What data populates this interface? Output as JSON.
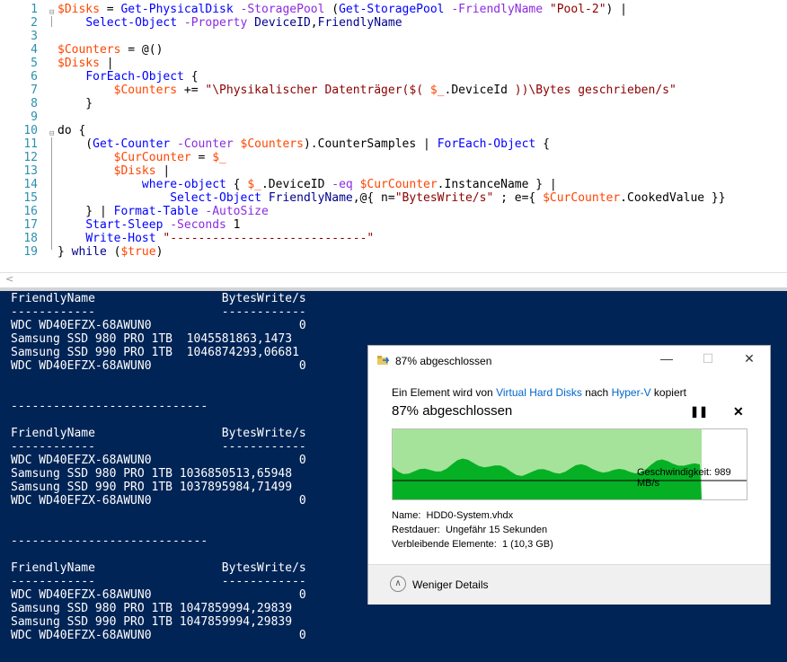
{
  "editor": {
    "line_numbers": [
      "1",
      "2",
      "3",
      "4",
      "5",
      "6",
      "7",
      "8",
      "9",
      "10",
      "11",
      "12",
      "13",
      "14",
      "15",
      "16",
      "17",
      "18",
      "19"
    ],
    "lines": [
      [
        {
          "c": "v",
          "t": "$Disks"
        },
        {
          "c": "t",
          "t": " = "
        },
        {
          "c": "c",
          "t": "Get-PhysicalDisk"
        },
        {
          "c": "t",
          "t": " "
        },
        {
          "c": "p",
          "t": "-StoragePool"
        },
        {
          "c": "t",
          "t": " ("
        },
        {
          "c": "c",
          "t": "Get-StoragePool"
        },
        {
          "c": "t",
          "t": " "
        },
        {
          "c": "p",
          "t": "-FriendlyName"
        },
        {
          "c": "t",
          "t": " "
        },
        {
          "c": "s",
          "t": "\"Pool-2\""
        },
        {
          "c": "t",
          "t": ") |"
        }
      ],
      [
        {
          "c": "t",
          "t": "    "
        },
        {
          "c": "c",
          "t": "Select-Object"
        },
        {
          "c": "t",
          "t": " "
        },
        {
          "c": "p",
          "t": "-Property"
        },
        {
          "c": "t",
          "t": " "
        },
        {
          "c": "k",
          "t": "DeviceID"
        },
        {
          "c": "t",
          "t": ","
        },
        {
          "c": "k",
          "t": "FriendlyName"
        }
      ],
      [],
      [
        {
          "c": "v",
          "t": "$Counters"
        },
        {
          "c": "t",
          "t": " = @()"
        }
      ],
      [
        {
          "c": "v",
          "t": "$Disks"
        },
        {
          "c": "t",
          "t": " |"
        }
      ],
      [
        {
          "c": "t",
          "t": "    "
        },
        {
          "c": "c",
          "t": "ForEach-Object"
        },
        {
          "c": "t",
          "t": " {"
        }
      ],
      [
        {
          "c": "t",
          "t": "        "
        },
        {
          "c": "v",
          "t": "$Counters"
        },
        {
          "c": "t",
          "t": " += "
        },
        {
          "c": "s",
          "t": "\"\\Physikalischer Datenträger($( "
        },
        {
          "c": "v",
          "t": "$_"
        },
        {
          "c": "t",
          "t": ".DeviceId "
        },
        {
          "c": "s",
          "t": "))\\Bytes geschrieben/s\""
        }
      ],
      [
        {
          "c": "t",
          "t": "    }"
        }
      ],
      [],
      [
        {
          "c": "t",
          "t": "do {"
        }
      ],
      [
        {
          "c": "t",
          "t": "    ("
        },
        {
          "c": "c",
          "t": "Get-Counter"
        },
        {
          "c": "t",
          "t": " "
        },
        {
          "c": "p",
          "t": "-Counter"
        },
        {
          "c": "t",
          "t": " "
        },
        {
          "c": "v",
          "t": "$Counters"
        },
        {
          "c": "t",
          "t": ").CounterSamples | "
        },
        {
          "c": "c",
          "t": "ForEach-Object"
        },
        {
          "c": "t",
          "t": " {"
        }
      ],
      [
        {
          "c": "t",
          "t": "        "
        },
        {
          "c": "v",
          "t": "$CurCounter"
        },
        {
          "c": "t",
          "t": " = "
        },
        {
          "c": "v",
          "t": "$_"
        }
      ],
      [
        {
          "c": "t",
          "t": "        "
        },
        {
          "c": "v",
          "t": "$Disks"
        },
        {
          "c": "t",
          "t": " |"
        }
      ],
      [
        {
          "c": "t",
          "t": "            "
        },
        {
          "c": "c",
          "t": "where-object"
        },
        {
          "c": "t",
          "t": " { "
        },
        {
          "c": "v",
          "t": "$_"
        },
        {
          "c": "t",
          "t": ".DeviceID "
        },
        {
          "c": "p",
          "t": "-eq"
        },
        {
          "c": "t",
          "t": " "
        },
        {
          "c": "v",
          "t": "$CurCounter"
        },
        {
          "c": "t",
          "t": ".InstanceName } |"
        }
      ],
      [
        {
          "c": "t",
          "t": "                "
        },
        {
          "c": "c",
          "t": "Select-Object"
        },
        {
          "c": "t",
          "t": " "
        },
        {
          "c": "k",
          "t": "FriendlyName"
        },
        {
          "c": "t",
          "t": ",@{ n="
        },
        {
          "c": "s",
          "t": "\"BytesWrite/s\""
        },
        {
          "c": "t",
          "t": " ; e={ "
        },
        {
          "c": "v",
          "t": "$CurCounter"
        },
        {
          "c": "t",
          "t": ".CookedValue }}"
        }
      ],
      [
        {
          "c": "t",
          "t": "    } | "
        },
        {
          "c": "c",
          "t": "Format-Table"
        },
        {
          "c": "t",
          "t": " "
        },
        {
          "c": "p",
          "t": "-AutoSize"
        }
      ],
      [
        {
          "c": "t",
          "t": "    "
        },
        {
          "c": "c",
          "t": "Start-Sleep"
        },
        {
          "c": "t",
          "t": " "
        },
        {
          "c": "p",
          "t": "-Seconds"
        },
        {
          "c": "t",
          "t": " 1"
        }
      ],
      [
        {
          "c": "t",
          "t": "    "
        },
        {
          "c": "c",
          "t": "Write-Host"
        },
        {
          "c": "t",
          "t": " "
        },
        {
          "c": "s",
          "t": "\"----------------------------\""
        }
      ],
      [
        {
          "c": "t",
          "t": "} "
        },
        {
          "c": "k",
          "t": "while"
        },
        {
          "c": "t",
          "t": " ("
        },
        {
          "c": "v",
          "t": "$true"
        },
        {
          "c": "t",
          "t": ")"
        }
      ]
    ]
  },
  "scroll_arrow": "<",
  "console": {
    "lines": [
      "FriendlyName                  BytesWrite/s",
      "------------                  ------------",
      "WDC WD40EFZX-68AWUN0                     0",
      "Samsung SSD 980 PRO 1TB  1045581863,1473",
      "Samsung SSD 990 PRO 1TB  1046874293,06681",
      "WDC WD40EFZX-68AWUN0                     0",
      "",
      "",
      "----------------------------",
      "",
      "FriendlyName                  BytesWrite/s",
      "------------                  ------------",
      "WDC WD40EFZX-68AWUN0                     0",
      "Samsung SSD 980 PRO 1TB 1036850513,65948",
      "Samsung SSD 990 PRO 1TB 1037895984,71499",
      "WDC WD40EFZX-68AWUN0                     0",
      "",
      "",
      "----------------------------",
      "",
      "FriendlyName                  BytesWrite/s",
      "------------                  ------------",
      "WDC WD40EFZX-68AWUN0                     0",
      "Samsung SSD 980 PRO 1TB 1047859994,29839",
      "Samsung SSD 990 PRO 1TB 1047859994,29839",
      "WDC WD40EFZX-68AWUN0                     0"
    ]
  },
  "dialog": {
    "title": "87% abgeschlossen",
    "desc_prefix": "Ein Element wird von ",
    "source": "Virtual Hard Disks",
    "desc_mid": " nach ",
    "target": "Hyper-V",
    "desc_suffix": " kopiert",
    "heading": "87% abgeschlossen",
    "progress": 0.87,
    "speed_label": "Geschwindigkeit: 989 MB/s",
    "name_label": "Name:",
    "name_value": "HDD0-System.vhdx",
    "remaining_label": "Restdauer:",
    "remaining_value": "Ungefähr 15 Sekunden",
    "items_label": "Verbleibende Elemente:",
    "items_value": "1 (10,3 GB)",
    "fewer_details": "Weniger Details",
    "colors": {
      "fill_light": "#a6e39a",
      "fill_dark": "#06b025"
    }
  }
}
